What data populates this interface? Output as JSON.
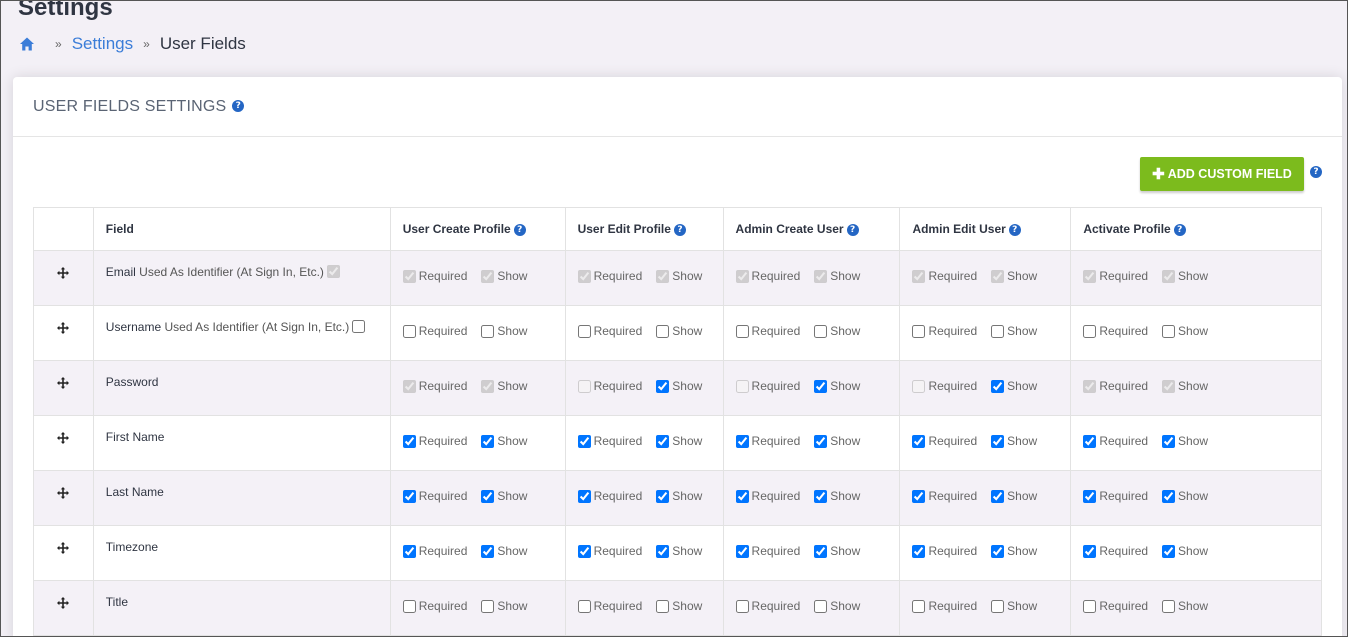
{
  "page": {
    "title": "Settings",
    "breadcrumb": {
      "settings": "Settings",
      "current": "User Fields"
    }
  },
  "card": {
    "title": "USER FIELDS SETTINGS",
    "add_button": "ADD CUSTOM FIELD"
  },
  "table": {
    "field_header": "Field",
    "columns": [
      "User Create Profile",
      "User Edit Profile",
      "Admin Create User",
      "Admin Edit User",
      "Activate Profile"
    ],
    "required_label": "Required",
    "show_label": "Show",
    "rows": [
      {
        "name": "Email",
        "note": "Used As Identifier (At Sign In, Etc.)",
        "identifier": {
          "checked": true,
          "disabled": true
        },
        "perms": [
          {
            "required": {
              "checked": true,
              "disabled": true
            },
            "show": {
              "checked": true,
              "disabled": true
            }
          },
          {
            "required": {
              "checked": true,
              "disabled": true
            },
            "show": {
              "checked": true,
              "disabled": true
            }
          },
          {
            "required": {
              "checked": true,
              "disabled": true
            },
            "show": {
              "checked": true,
              "disabled": true
            }
          },
          {
            "required": {
              "checked": true,
              "disabled": true
            },
            "show": {
              "checked": true,
              "disabled": true
            }
          },
          {
            "required": {
              "checked": true,
              "disabled": true
            },
            "show": {
              "checked": true,
              "disabled": true
            }
          }
        ]
      },
      {
        "name": "Username",
        "note": "Used As Identifier (At Sign In, Etc.)",
        "identifier": {
          "checked": false,
          "disabled": false
        },
        "perms": [
          {
            "required": {
              "checked": false,
              "disabled": false
            },
            "show": {
              "checked": false,
              "disabled": false
            }
          },
          {
            "required": {
              "checked": false,
              "disabled": false
            },
            "show": {
              "checked": false,
              "disabled": false
            }
          },
          {
            "required": {
              "checked": false,
              "disabled": false
            },
            "show": {
              "checked": false,
              "disabled": false
            }
          },
          {
            "required": {
              "checked": false,
              "disabled": false
            },
            "show": {
              "checked": false,
              "disabled": false
            }
          },
          {
            "required": {
              "checked": false,
              "disabled": false
            },
            "show": {
              "checked": false,
              "disabled": false
            }
          }
        ]
      },
      {
        "name": "Password",
        "perms": [
          {
            "required": {
              "checked": true,
              "disabled": true
            },
            "show": {
              "checked": true,
              "disabled": true
            }
          },
          {
            "required": {
              "checked": false,
              "disabled": true
            },
            "show": {
              "checked": true,
              "disabled": false
            }
          },
          {
            "required": {
              "checked": false,
              "disabled": true
            },
            "show": {
              "checked": true,
              "disabled": false
            }
          },
          {
            "required": {
              "checked": false,
              "disabled": true
            },
            "show": {
              "checked": true,
              "disabled": false
            }
          },
          {
            "required": {
              "checked": true,
              "disabled": true
            },
            "show": {
              "checked": true,
              "disabled": true
            }
          }
        ]
      },
      {
        "name": "First Name",
        "perms": [
          {
            "required": {
              "checked": true,
              "disabled": false
            },
            "show": {
              "checked": true,
              "disabled": false
            }
          },
          {
            "required": {
              "checked": true,
              "disabled": false
            },
            "show": {
              "checked": true,
              "disabled": false
            }
          },
          {
            "required": {
              "checked": true,
              "disabled": false
            },
            "show": {
              "checked": true,
              "disabled": false
            }
          },
          {
            "required": {
              "checked": true,
              "disabled": false
            },
            "show": {
              "checked": true,
              "disabled": false
            }
          },
          {
            "required": {
              "checked": true,
              "disabled": false
            },
            "show": {
              "checked": true,
              "disabled": false
            }
          }
        ]
      },
      {
        "name": "Last Name",
        "perms": [
          {
            "required": {
              "checked": true,
              "disabled": false
            },
            "show": {
              "checked": true,
              "disabled": false
            }
          },
          {
            "required": {
              "checked": true,
              "disabled": false
            },
            "show": {
              "checked": true,
              "disabled": false
            }
          },
          {
            "required": {
              "checked": true,
              "disabled": false
            },
            "show": {
              "checked": true,
              "disabled": false
            }
          },
          {
            "required": {
              "checked": true,
              "disabled": false
            },
            "show": {
              "checked": true,
              "disabled": false
            }
          },
          {
            "required": {
              "checked": true,
              "disabled": false
            },
            "show": {
              "checked": true,
              "disabled": false
            }
          }
        ]
      },
      {
        "name": "Timezone",
        "perms": [
          {
            "required": {
              "checked": true,
              "disabled": false
            },
            "show": {
              "checked": true,
              "disabled": false
            }
          },
          {
            "required": {
              "checked": true,
              "disabled": false
            },
            "show": {
              "checked": true,
              "disabled": false
            }
          },
          {
            "required": {
              "checked": true,
              "disabled": false
            },
            "show": {
              "checked": true,
              "disabled": false
            }
          },
          {
            "required": {
              "checked": true,
              "disabled": false
            },
            "show": {
              "checked": true,
              "disabled": false
            }
          },
          {
            "required": {
              "checked": true,
              "disabled": false
            },
            "show": {
              "checked": true,
              "disabled": false
            }
          }
        ]
      },
      {
        "name": "Title",
        "perms": [
          {
            "required": {
              "checked": false,
              "disabled": false
            },
            "show": {
              "checked": false,
              "disabled": false
            }
          },
          {
            "required": {
              "checked": false,
              "disabled": false
            },
            "show": {
              "checked": false,
              "disabled": false
            }
          },
          {
            "required": {
              "checked": false,
              "disabled": false
            },
            "show": {
              "checked": false,
              "disabled": false
            }
          },
          {
            "required": {
              "checked": false,
              "disabled": false
            },
            "show": {
              "checked": false,
              "disabled": false
            }
          },
          {
            "required": {
              "checked": false,
              "disabled": false
            },
            "show": {
              "checked": false,
              "disabled": false
            }
          }
        ]
      }
    ]
  },
  "colors": {
    "accent": "#3b7dd8",
    "button": "#7cbb1d",
    "help_icon": "#2466c4",
    "stripe": "#f4f1f7"
  },
  "icons": {
    "home": "home-icon",
    "help": "help-circle-icon",
    "drag": "move-icon",
    "add": "plus-icon"
  }
}
